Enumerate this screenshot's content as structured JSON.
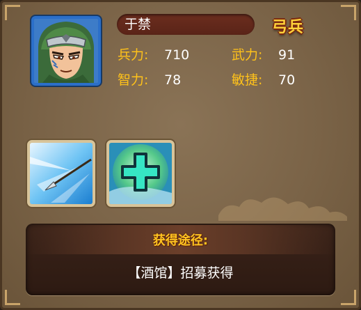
{
  "hero": {
    "name": "于禁",
    "unit_type": "弓兵",
    "portrait_icon": "hero-portrait-yu-jin"
  },
  "stats": [
    {
      "label": "兵力:",
      "value": "710"
    },
    {
      "label": "武力:",
      "value": "91"
    },
    {
      "label": "智力:",
      "value": "78"
    },
    {
      "label": "敏捷:",
      "value": "70"
    }
  ],
  "skills": [
    {
      "icon": "spear-thrust-icon"
    },
    {
      "icon": "heal-cross-icon"
    }
  ],
  "acquire": {
    "title": "获得途径:",
    "text": "【酒馆】招募获得"
  },
  "colors": {
    "label": "#ffc21a",
    "value": "#ffffff",
    "unit_type": "#ffd23a",
    "panel_bg": "#7a6347",
    "portrait_border": "#2b6fc9"
  }
}
